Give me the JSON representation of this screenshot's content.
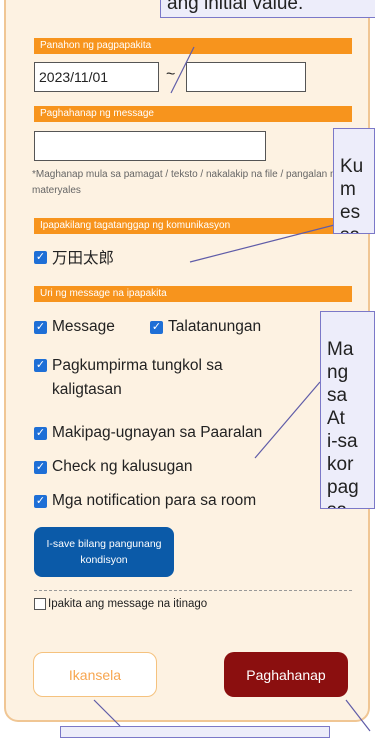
{
  "top_callout": {
    "text": "ang initial value."
  },
  "period": {
    "header": "Panahon ng pagpapakita",
    "from_value": "2023/11/01",
    "separator": "~",
    "to_value": ""
  },
  "message_search": {
    "header": "Paghahanap ng message",
    "value": "",
    "hint": "*Maghanap mula sa pamagat / teksto / nakalakip na file / pangalan ng materyales"
  },
  "recipient": {
    "header": "Ipapakilang tagatanggap ng komunikasyon",
    "name": "万田太郎"
  },
  "message_types": {
    "header": "Uri ng message na ipapakita",
    "items": [
      "Message",
      "Talatanungan",
      "Pagkumpirma tungkol sa kaligtasan",
      "Makipag-ugnayan sa Paaralan",
      "Check ng kalusugan",
      "Mga notification para sa room"
    ]
  },
  "save_button": {
    "label": "I-save bilang pangunang kondisyon"
  },
  "hidden_toggle": {
    "label": "Ipakita ang message na itinago"
  },
  "cancel_button": {
    "label": "Ikansela"
  },
  "search_button": {
    "label": "Paghahanap"
  },
  "callouts": {
    "right_1": "Ku\nm\nes\nsa",
    "right_2": "Ma\nng\nsa\nAt\ni-sa\nkor\npag\nsa"
  },
  "colors": {
    "accent_orange": "#f7941d",
    "panel_bg": "#fdf2e2",
    "save_blue": "#0b5aa8",
    "search_red": "#8b0f0f",
    "callout_bg": "#ededfa"
  }
}
